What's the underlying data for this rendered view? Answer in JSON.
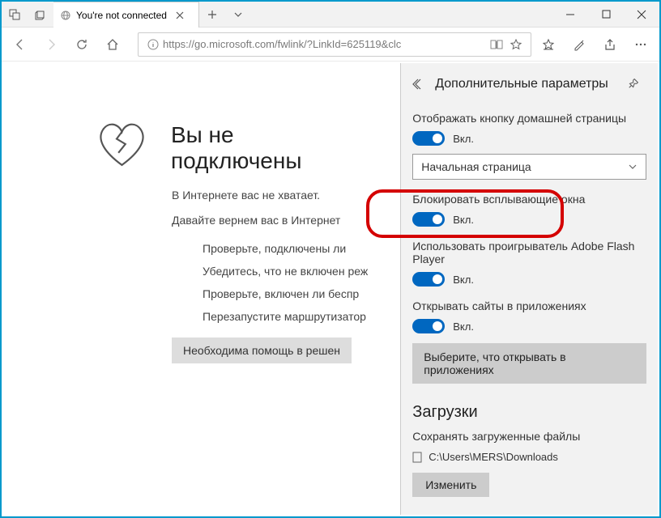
{
  "tab": {
    "title": "You're not connected"
  },
  "url": {
    "protocol": "https://",
    "rest": "go.microsoft.com/fwlink/?LinkId=625119&clc"
  },
  "error": {
    "title": "Вы не подключены",
    "subtitle": "В Интернете вас не хватает.",
    "body": "Давайте вернем вас в Интернет",
    "bullets": [
      "Проверьте, подключены ли",
      "Убедитесь, что не включен реж",
      "Проверьте, включен ли беспр",
      "Перезапустите маршрутизатор"
    ],
    "help_button": "Необходима помощь в решен"
  },
  "panel": {
    "title": "Дополнительные параметры",
    "home_button": {
      "label": "Отображать кнопку домашней страницы",
      "state": "Вкл."
    },
    "start_page_dropdown": "Начальная страница",
    "popup_block": {
      "label": "Блокировать всплывающие окна",
      "state": "Вкл."
    },
    "flash": {
      "label": "Использовать проигрыватель Adobe Flash Player",
      "state": "Вкл."
    },
    "open_apps": {
      "label": "Открывать сайты в приложениях",
      "state": "Вкл."
    },
    "choose_apps_btn": "Выберите, что открывать в приложениях",
    "downloads_title": "Загрузки",
    "downloads_label": "Сохранять загруженные файлы",
    "downloads_path": "C:\\Users\\MERS\\Downloads",
    "change_btn": "Изменить"
  }
}
